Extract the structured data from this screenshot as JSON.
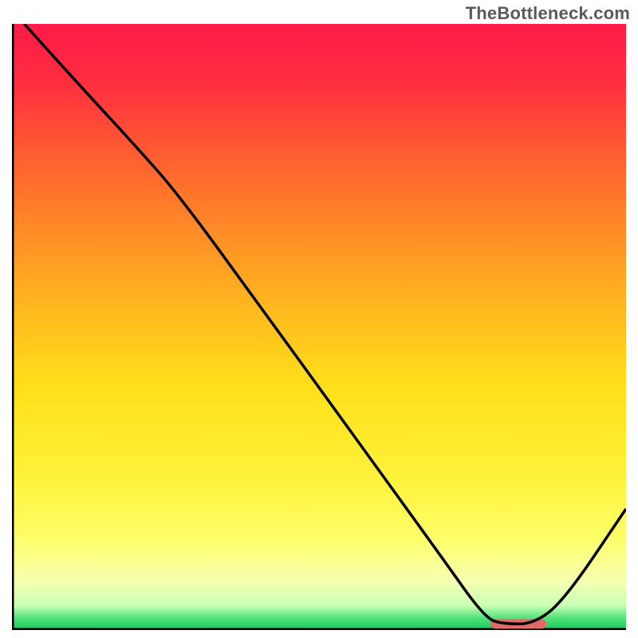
{
  "watermark": "TheBottleneck.com",
  "chart_data": {
    "type": "line",
    "title": "",
    "xlabel": "",
    "ylabel": "",
    "xlim": [
      0,
      100
    ],
    "ylim": [
      0,
      100
    ],
    "series": [
      {
        "name": "curve",
        "x": [
          2,
          10,
          20,
          27,
          40,
          55,
          70,
          77,
          80,
          85,
          90,
          100
        ],
        "y": [
          100,
          91,
          80,
          72,
          54,
          33,
          12,
          2,
          1,
          1,
          5,
          20
        ]
      }
    ],
    "optimal_marker": {
      "x_start": 78,
      "x_end": 87,
      "y": 1
    },
    "gradient_stops": [
      {
        "pct": 0,
        "color": "#ff1a47"
      },
      {
        "pct": 10,
        "color": "#ff2f3f"
      },
      {
        "pct": 25,
        "color": "#ff6a2d"
      },
      {
        "pct": 45,
        "color": "#ffb21f"
      },
      {
        "pct": 60,
        "color": "#ffe01a"
      },
      {
        "pct": 75,
        "color": "#fff23a"
      },
      {
        "pct": 85,
        "color": "#fdff6a"
      },
      {
        "pct": 92,
        "color": "#f5ffb0"
      },
      {
        "pct": 96,
        "color": "#c8ffb4"
      },
      {
        "pct": 98,
        "color": "#54e27a"
      },
      {
        "pct": 100,
        "color": "#17c85f"
      }
    ],
    "axis_color": "#000000",
    "curve_color": "#000000",
    "marker_color": "#e46a6a"
  }
}
